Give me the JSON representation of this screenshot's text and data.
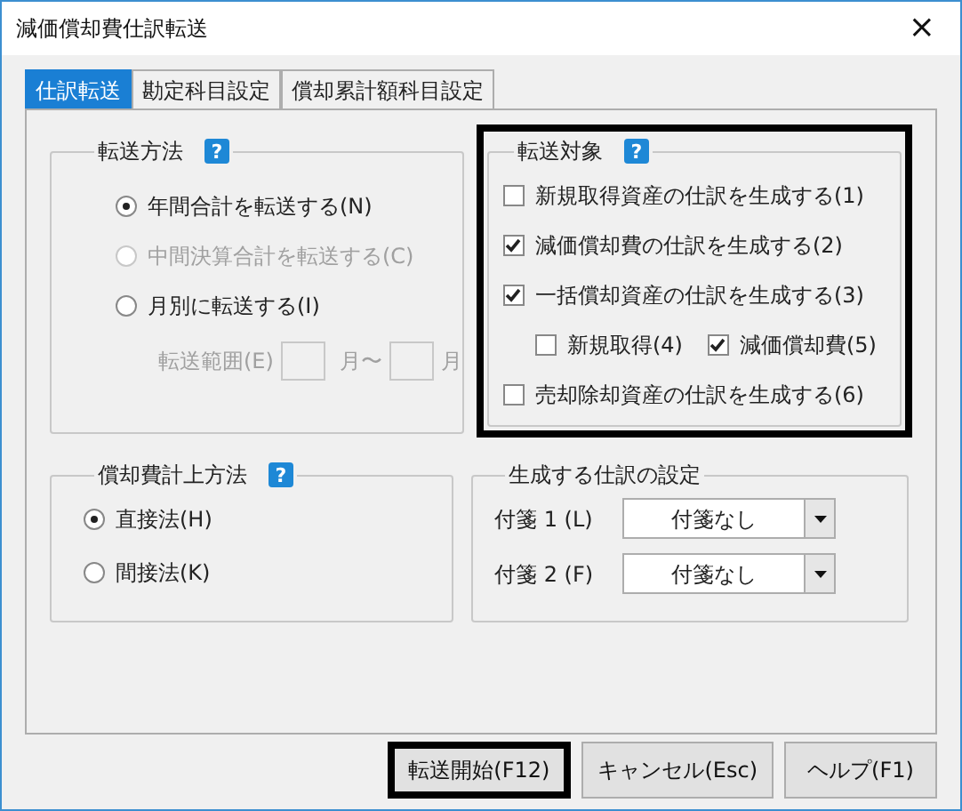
{
  "window": {
    "title": "減価償却費仕訳転送",
    "close": "×"
  },
  "tabs": [
    {
      "label": "仕訳転送",
      "selected": true
    },
    {
      "label": "勘定科目設定",
      "selected": false
    },
    {
      "label": "償却累計額科目設定",
      "selected": false
    }
  ],
  "transfer_method": {
    "title": "転送方法",
    "help": "?",
    "options": [
      {
        "label": "年間合計を転送する(N)",
        "selected": true,
        "disabled": false
      },
      {
        "label": "中間決算合計を転送する(C)",
        "selected": false,
        "disabled": true
      },
      {
        "label": "月別に転送する(I)",
        "selected": false,
        "disabled": false
      }
    ],
    "range": {
      "label": "転送範囲(E)",
      "from_unit": "月〜",
      "to_unit": "月",
      "disabled": true
    }
  },
  "transfer_target": {
    "title": "転送対象",
    "help": "?",
    "highlighted": true,
    "items": [
      {
        "label": "新規取得資産の仕訳を生成する(1)",
        "checked": false
      },
      {
        "label": "減価償却費の仕訳を生成する(2)",
        "checked": true
      },
      {
        "label": "一括償却資産の仕訳を生成する(3)",
        "checked": true,
        "children": [
          {
            "label": "新規取得(4)",
            "checked": false
          },
          {
            "label": "減価償却費(5)",
            "checked": true
          }
        ]
      },
      {
        "label": "売却除却資産の仕訳を生成する(6)",
        "checked": false
      }
    ]
  },
  "depreciation_method": {
    "title": "償却費計上方法",
    "help": "?",
    "options": [
      {
        "label": "直接法(H)",
        "selected": true
      },
      {
        "label": "間接法(K)",
        "selected": false
      }
    ]
  },
  "entry_settings": {
    "title": "生成する仕訳の設定",
    "fields": [
      {
        "label": "付箋 1 (L)",
        "value": "付箋なし"
      },
      {
        "label": "付箋 2 (F)",
        "value": "付箋なし"
      }
    ]
  },
  "buttons": [
    {
      "label": "転送開始(F12)",
      "highlighted": true
    },
    {
      "label": "キャンセル(Esc)",
      "highlighted": false
    },
    {
      "label": "ヘルプ(F1)",
      "highlighted": false
    }
  ]
}
